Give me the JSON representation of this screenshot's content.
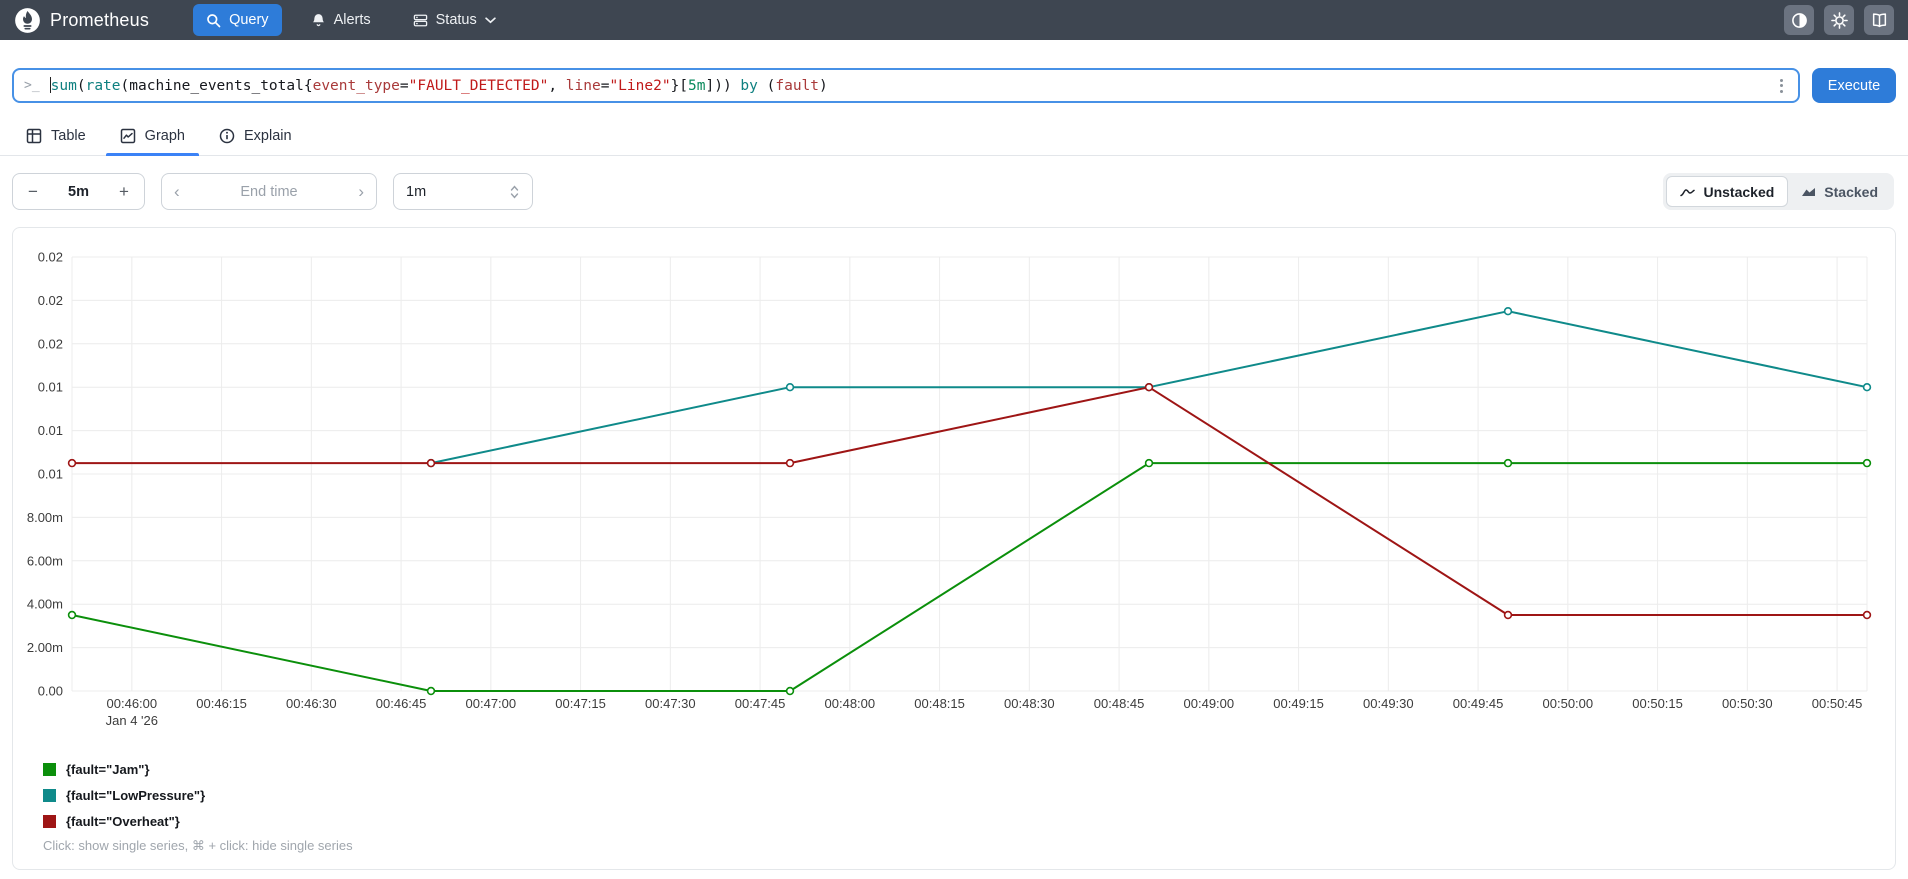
{
  "navbar": {
    "brand": "Prometheus",
    "items": [
      {
        "label": "Query",
        "icon": "search-icon",
        "active": true
      },
      {
        "label": "Alerts",
        "icon": "bell-icon",
        "active": false
      },
      {
        "label": "Status",
        "icon": "server-icon",
        "active": false,
        "has_chevron": true
      }
    ],
    "right_icons": [
      "theme-contrast-icon",
      "settings-gear-icon",
      "docs-book-icon"
    ],
    "colors": {
      "bg": "#3e4651",
      "active_button": "#2e7cd9"
    }
  },
  "query_bar": {
    "query": "sum(rate(machine_events_total{event_type=\"FAULT_DETECTED\", line=\"Line2\"}[5m])) by (fault)",
    "segments": [
      {
        "text": "sum",
        "cls": "fn"
      },
      {
        "text": "(",
        "cls": "p"
      },
      {
        "text": "rate",
        "cls": "fn"
      },
      {
        "text": "(",
        "cls": "p"
      },
      {
        "text": "machine_events_total",
        "cls": "p"
      },
      {
        "text": "{",
        "cls": "p"
      },
      {
        "text": "event_type",
        "cls": "lbl"
      },
      {
        "text": "=",
        "cls": "p"
      },
      {
        "text": "\"FAULT_DETECTED\"",
        "cls": "str"
      },
      {
        "text": ", ",
        "cls": "p"
      },
      {
        "text": "line",
        "cls": "lbl"
      },
      {
        "text": "=",
        "cls": "p"
      },
      {
        "text": "\"Line2\"",
        "cls": "str"
      },
      {
        "text": "}[",
        "cls": "p"
      },
      {
        "text": "5m",
        "cls": "dur"
      },
      {
        "text": "])) ",
        "cls": "p"
      },
      {
        "text": "by",
        "cls": "kw"
      },
      {
        "text": " (",
        "cls": "p"
      },
      {
        "text": "fault",
        "cls": "lbl"
      },
      {
        "text": ")",
        "cls": "p"
      }
    ],
    "execute_label": "Execute"
  },
  "tabs": [
    {
      "label": "Table",
      "icon": "table-icon",
      "active": false
    },
    {
      "label": "Graph",
      "icon": "graph-icon",
      "active": true
    },
    {
      "label": "Explain",
      "icon": "info-icon",
      "active": false
    }
  ],
  "controls": {
    "duration": {
      "minus": "−",
      "value": "5m",
      "plus": "+"
    },
    "end_time": {
      "prev": "‹",
      "placeholder": "End time",
      "next": "›"
    },
    "resolution": {
      "value": "1m"
    },
    "stacking": {
      "options": [
        "Unstacked",
        "Stacked"
      ],
      "selected": "Unstacked"
    }
  },
  "chart_data": {
    "type": "line",
    "title": "",
    "xlabel": "",
    "ylabel": "",
    "ylim": [
      0,
      0.02
    ],
    "x_range": [
      "00:45:50",
      "00:50:50"
    ],
    "x_date_label": "Jan 4 '26",
    "grid": true,
    "yticks": [
      {
        "v": 0.02,
        "label": "0.02"
      },
      {
        "v": 0.018,
        "label": "0.02"
      },
      {
        "v": 0.016,
        "label": "0.02"
      },
      {
        "v": 0.014,
        "label": "0.01"
      },
      {
        "v": 0.012,
        "label": "0.01"
      },
      {
        "v": 0.01,
        "label": "0.01"
      },
      {
        "v": 0.008,
        "label": "8.00m"
      },
      {
        "v": 0.006,
        "label": "6.00m"
      },
      {
        "v": 0.004,
        "label": "4.00m"
      },
      {
        "v": 0.002,
        "label": "2.00m"
      },
      {
        "v": 0.0,
        "label": "0.00"
      }
    ],
    "xticks": [
      "00:46:00",
      "00:46:15",
      "00:46:30",
      "00:46:45",
      "00:47:00",
      "00:47:15",
      "00:47:30",
      "00:47:45",
      "00:48:00",
      "00:48:15",
      "00:48:30",
      "00:48:45",
      "00:49:00",
      "00:49:15",
      "00:49:30",
      "00:49:45",
      "00:50:00",
      "00:50:15",
      "00:50:30",
      "00:50:45"
    ],
    "series": [
      {
        "name": "{fault=\"Jam\"}",
        "color": "#0b8f0b",
        "points": [
          [
            "00:45:50",
            0.0035
          ],
          [
            "00:46:50",
            0.0
          ],
          [
            "00:47:50",
            0.0
          ],
          [
            "00:48:50",
            0.0105
          ],
          [
            "00:49:50",
            0.0105
          ],
          [
            "00:50:50",
            0.0105
          ]
        ]
      },
      {
        "name": "{fault=\"LowPressure\"}",
        "color": "#0f8a8a",
        "points": [
          [
            "00:46:50",
            0.0105
          ],
          [
            "00:47:50",
            0.014
          ],
          [
            "00:48:50",
            0.014
          ],
          [
            "00:49:50",
            0.0175
          ],
          [
            "00:50:50",
            0.014
          ]
        ]
      },
      {
        "name": "{fault=\"Overheat\"}",
        "color": "#9e1515",
        "points": [
          [
            "00:45:50",
            0.0105
          ],
          [
            "00:46:50",
            0.0105
          ],
          [
            "00:47:50",
            0.0105
          ],
          [
            "00:48:50",
            0.014
          ],
          [
            "00:49:50",
            0.0035
          ],
          [
            "00:50:50",
            0.0035
          ]
        ]
      }
    ],
    "legend_position": "bottom-left"
  },
  "legend": {
    "hint": "Click: show single series, ⌘ + click: hide single series"
  }
}
